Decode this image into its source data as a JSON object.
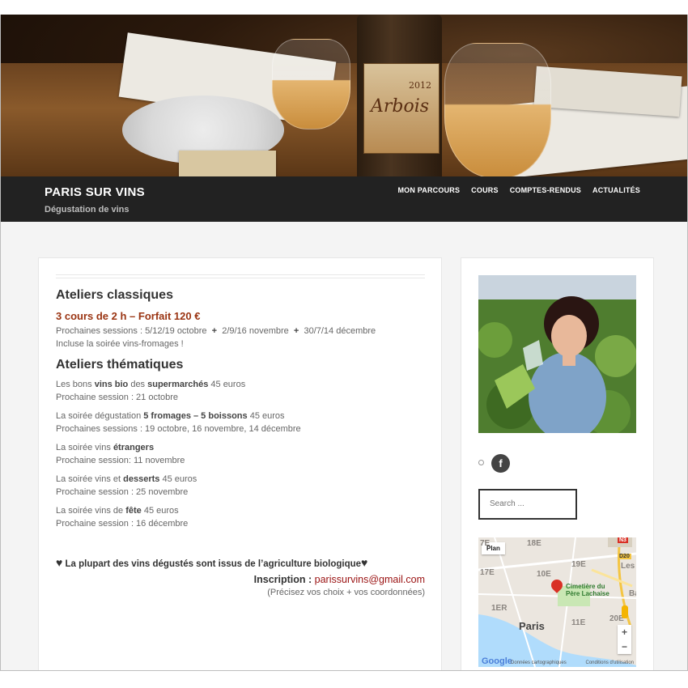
{
  "site": {
    "title": "PARIS SUR VINS",
    "tagline": "Dégustation de vins"
  },
  "hero": {
    "bottle_label": "Arbois",
    "bottle_year": "2012"
  },
  "nav": [
    {
      "label": "MON PARCOURS"
    },
    {
      "label": "COURS"
    },
    {
      "label": "COMPTES-RENDUS"
    },
    {
      "label": "ACTUALITÉS"
    }
  ],
  "main": {
    "classiques": {
      "heading": "Ateliers classiques",
      "offer": "3 cours de 2 h – Forfait 120 €",
      "sessions_label": "Prochaines sessions : ",
      "sessions_1": "5/12/19 octobre",
      "sessions_2": "2/9/16 novembre",
      "sessions_3": "30/7/14 décembre",
      "plus": "+",
      "includes": "Incluse la soirée vins-fromages !"
    },
    "thematiques": {
      "heading": "Ateliers thématiques",
      "items": [
        {
          "pre": "Les bons ",
          "b1": "vins bio",
          "mid": " des ",
          "b2": "supermarchés",
          "post": "  45 euros",
          "session": "Prochaine session : 21 octobre"
        },
        {
          "pre": "La soirée dégustation ",
          "b1": "5 fromages – 5 boissons",
          "post": " 45 euros",
          "session": "Prochaines sessions : 19 octobre, 16 novembre, 14 décembre"
        },
        {
          "pre": "La soirée vins ",
          "b1": "étrangers",
          "post": "",
          "session": "Prochaine session: 11 novembre"
        },
        {
          "pre": "La soirée vins et ",
          "b1": "desserts",
          "post": " 45 euros",
          "session": "Prochaine session : 25 novembre"
        },
        {
          "pre": "La soirée vins de ",
          "b1": "fête",
          "post": " 45 euros",
          "session": "Prochaine session : 16 décembre"
        }
      ]
    },
    "closing": {
      "heart": "♥",
      "note": " La plupart des vins dégustés sont issus de l’agriculture biologique",
      "inscription_label": "Inscription : ",
      "email": "parissurvins@gmail.com",
      "precise": "(Précisez vos choix + vos coordonnées)"
    }
  },
  "sidebar": {
    "facebook_glyph": "f",
    "search_placeholder": "Search ...",
    "map": {
      "type_button": "Plan",
      "city": "Paris",
      "labels": [
        "7E",
        "18E",
        "19E",
        "17E",
        "10E",
        "20E",
        "1ER",
        "11E",
        "Cimetière du Père Lachaise",
        "Les",
        "Ba",
        "N3",
        "D20"
      ],
      "google": "Google",
      "credits": "Données cartographiques",
      "conditions": "Conditions d'utilisation",
      "zoom_in": "+",
      "zoom_out": "−"
    }
  }
}
